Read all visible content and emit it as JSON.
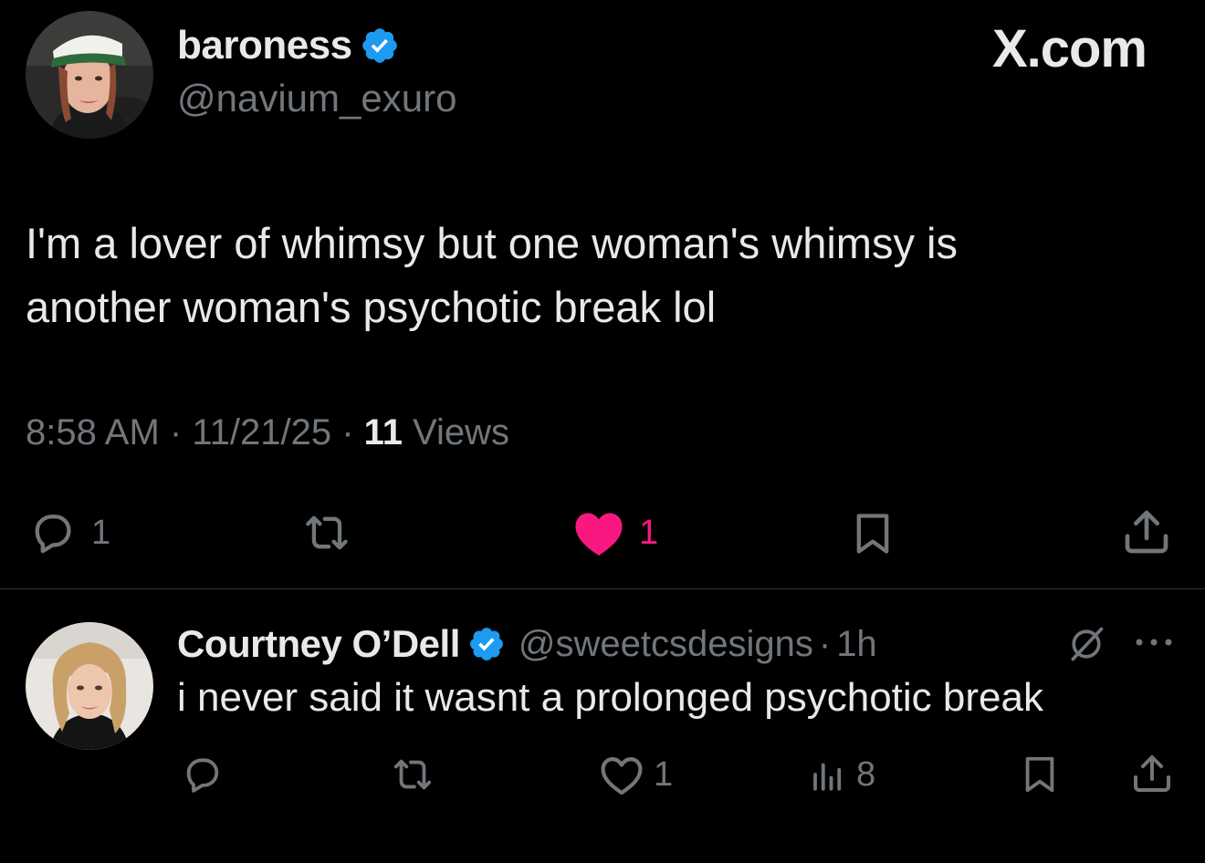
{
  "site": {
    "brand": "X.com"
  },
  "tweet": {
    "author": {
      "name": "baroness",
      "handle": "@navium_exuro",
      "verified": true
    },
    "text_line1": "I'm a lover of whimsy but one woman's whimsy is",
    "text_line2": "another woman's psychotic break lol",
    "time": "8:58 AM",
    "date": "11/21/25",
    "separator": "·",
    "views_count": "11",
    "views_label": "Views",
    "actions": {
      "reply_count": "1",
      "retweet_count": "",
      "like_count": "1",
      "liked": true
    }
  },
  "reply": {
    "author": {
      "name": "Courtney O’Dell",
      "handle": "@sweetcsdesigns",
      "verified": true
    },
    "separator": "·",
    "time": "1h",
    "text": "i never said it wasnt a prolonged psychotic break",
    "actions": {
      "reply_count": "",
      "retweet_count": "",
      "like_count": "1",
      "views_count": "8"
    }
  },
  "icons": {
    "verified": "verified-badge-icon",
    "reply": "speech-bubble-icon",
    "retweet": "retweet-icon",
    "like": "heart-icon",
    "bookmark": "bookmark-icon",
    "share": "share-icon",
    "views": "bar-chart-icon",
    "grok": "grok-icon",
    "more": "more-dots-icon"
  },
  "colors": {
    "background": "#000000",
    "text_primary": "#e7e9ea",
    "text_secondary": "#71767b",
    "verified_blue": "#1d9bf0",
    "like_pink": "#f91880",
    "divider": "#2f3336"
  }
}
